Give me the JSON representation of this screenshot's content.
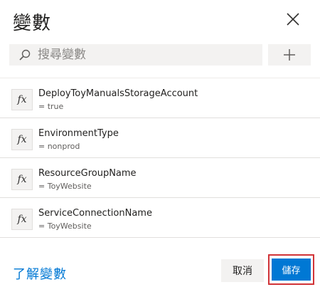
{
  "dialog": {
    "title": "變數",
    "close_icon": "close-icon"
  },
  "search": {
    "placeholder": "搜尋變數",
    "value": "",
    "icon": "search-icon"
  },
  "add_button": {
    "icon": "plus-icon"
  },
  "variables": [
    {
      "icon": "fx-icon",
      "name": "DeployToyManualsStorageAccount",
      "value": "= true"
    },
    {
      "icon": "fx-icon",
      "name": "EnvironmentType",
      "value": "= nonprod"
    },
    {
      "icon": "fx-icon",
      "name": "ResourceGroupName",
      "value": "= ToyWebsite"
    },
    {
      "icon": "fx-icon",
      "name": "ServiceConnectionName",
      "value": "= ToyWebsite"
    }
  ],
  "footer": {
    "learn_link": "了解變數",
    "cancel_label": "取消",
    "save_label": "儲存"
  },
  "colors": {
    "accent": "#0078d4",
    "highlight": "#d13438"
  }
}
